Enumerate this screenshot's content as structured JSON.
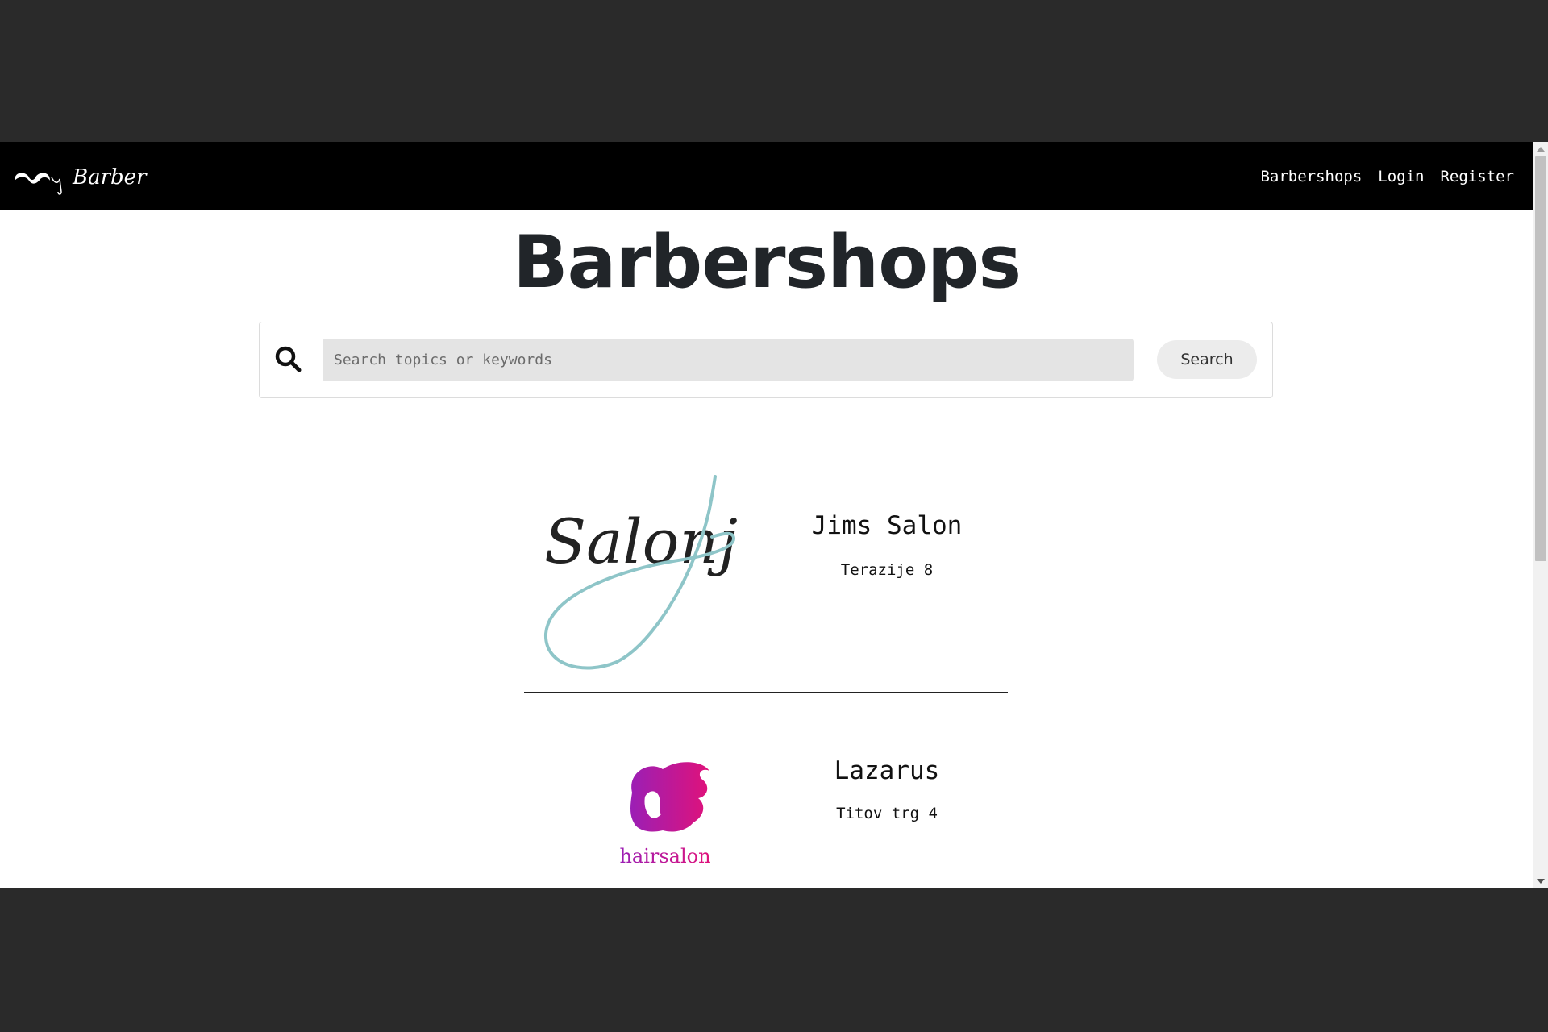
{
  "navbar": {
    "logo_text": "My Barber",
    "links": [
      {
        "label": "Barbershops"
      },
      {
        "label": "Login"
      },
      {
        "label": "Register"
      }
    ]
  },
  "main": {
    "title": "Barbershops",
    "search": {
      "placeholder": "Search topics or keywords",
      "value": "",
      "button_label": "Search"
    },
    "shops": [
      {
        "name": "Jims Salon",
        "address": "Terazije 8",
        "logo_text": "Salonj",
        "logo_icon": "salonj-logo"
      },
      {
        "name": "Lazarus",
        "address": "Titov trg 4",
        "logo_text": "hairsalon",
        "logo_icon": "hairsalon-logo"
      }
    ]
  },
  "colors": {
    "navbar_bg": "#000000",
    "page_bg": "#ffffff",
    "outer_bg": "#2a2a2a",
    "salonj_accent": "#8ec5c8",
    "hairsalon_gradient_start": "#9b1fb5",
    "hairsalon_gradient_end": "#e0127a"
  }
}
